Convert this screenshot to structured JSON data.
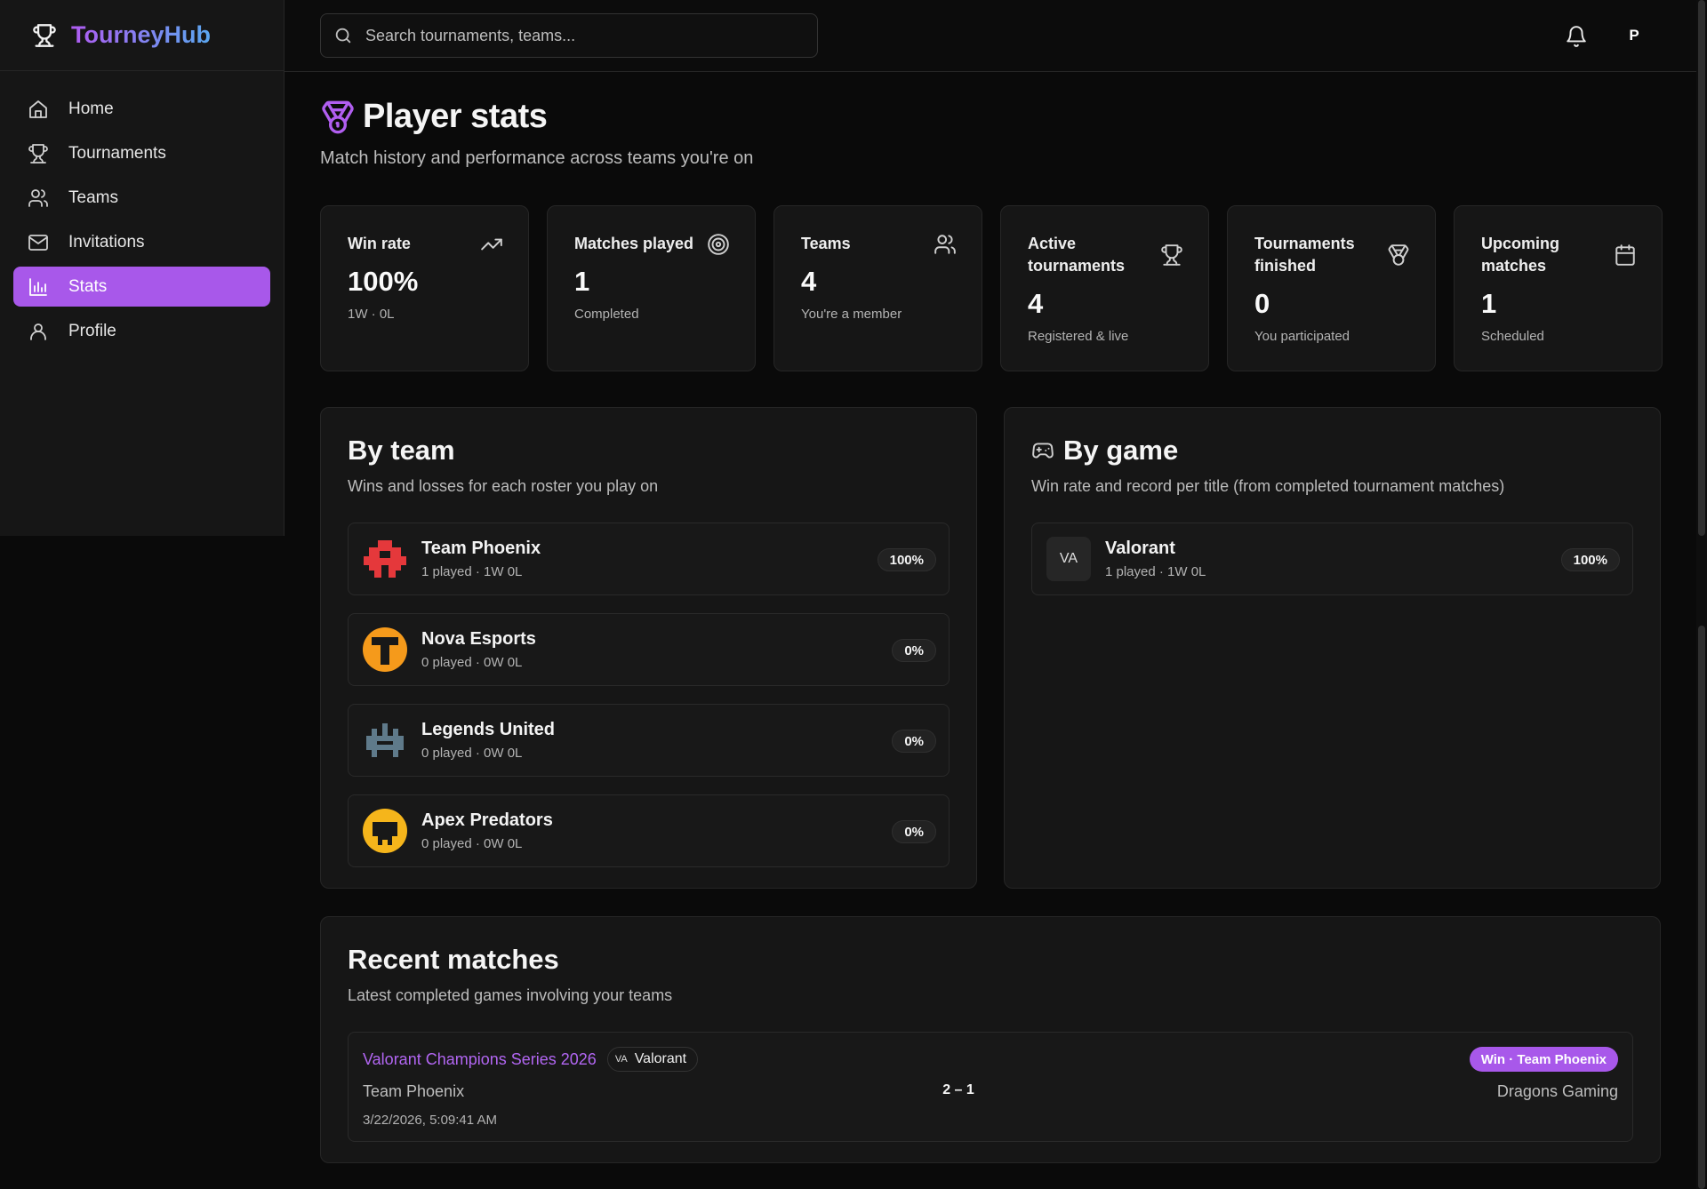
{
  "app": {
    "name": "TourneyHub"
  },
  "nav": {
    "items": [
      {
        "label": "Home",
        "icon": "home-icon",
        "active": false
      },
      {
        "label": "Tournaments",
        "icon": "trophy-icon",
        "active": false
      },
      {
        "label": "Teams",
        "icon": "users-icon",
        "active": false
      },
      {
        "label": "Invitations",
        "icon": "mail-icon",
        "active": false
      },
      {
        "label": "Stats",
        "icon": "bar-chart-icon",
        "active": true
      },
      {
        "label": "Profile",
        "icon": "user-icon",
        "active": false
      }
    ]
  },
  "topbar": {
    "search_placeholder": "Search tournaments, teams...",
    "search_value": "",
    "avatar_initial": "P"
  },
  "page": {
    "title": "Player stats",
    "subtitle": "Match history and performance across teams you're on"
  },
  "stats": [
    {
      "label": "Win rate",
      "value": "100%",
      "caption": "1W · 0L",
      "icon": "trending-up-icon"
    },
    {
      "label": "Matches played",
      "value": "1",
      "caption": "Completed",
      "icon": "target-icon"
    },
    {
      "label": "Teams",
      "value": "4",
      "caption": "You're a member",
      "icon": "users-icon"
    },
    {
      "label": "Active tournaments",
      "value": "4",
      "caption": "Registered & live",
      "icon": "trophy-icon"
    },
    {
      "label": "Tournaments finished",
      "value": "0",
      "caption": "You participated",
      "icon": "medal-icon"
    },
    {
      "label": "Upcoming matches",
      "value": "1",
      "caption": "Scheduled",
      "icon": "calendar-icon"
    }
  ],
  "by_team": {
    "title": "By team",
    "subtitle": "Wins and losses for each roster you play on",
    "teams": [
      {
        "name": "Team Phoenix",
        "record": "1 played · 1W 0L",
        "pct": "100%",
        "logo_color": "#e5383b"
      },
      {
        "name": "Nova Esports",
        "record": "0 played · 0W 0L",
        "pct": "0%",
        "logo_color": "#f59a1b"
      },
      {
        "name": "Legends United",
        "record": "0 played · 0W 0L",
        "pct": "0%",
        "logo_color": "#5f7a8a"
      },
      {
        "name": "Apex Predators",
        "record": "0 played · 0W 0L",
        "pct": "0%",
        "logo_color": "#f5b51b"
      }
    ]
  },
  "by_game": {
    "title": "By game",
    "subtitle": "Win rate and record per title (from completed tournament matches)",
    "games": [
      {
        "abbr": "VA",
        "name": "Valorant",
        "record": "1 played · 1W 0L",
        "pct": "100%"
      }
    ]
  },
  "recent": {
    "title": "Recent matches",
    "subtitle": "Latest completed games involving your teams",
    "matches": [
      {
        "tournament": "Valorant Champions Series 2026",
        "game_abbr": "VA",
        "game": "Valorant",
        "result": "Win · Team Phoenix",
        "home": "Team Phoenix",
        "score": "2 – 1",
        "away": "Dragons Gaming",
        "date": "3/22/2026, 5:09:41 AM"
      }
    ]
  },
  "colors": {
    "accent": "#a858ea",
    "background": "#0a0a0a",
    "card": "#161616"
  }
}
